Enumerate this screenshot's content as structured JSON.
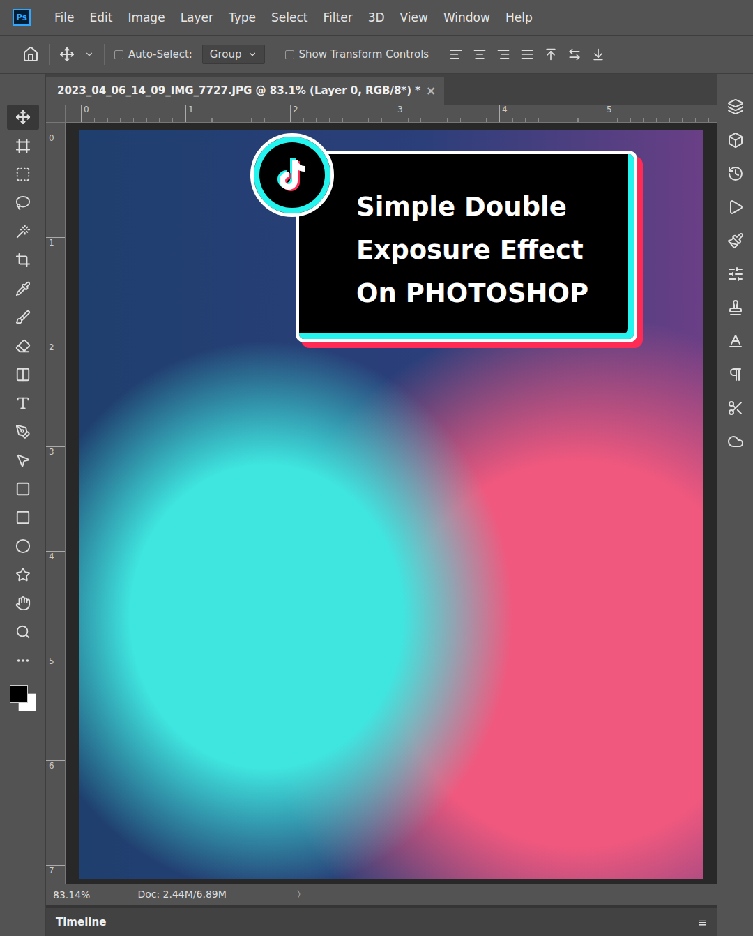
{
  "app": {
    "logo": "Ps"
  },
  "menu": [
    "File",
    "Edit",
    "Image",
    "Layer",
    "Type",
    "Select",
    "Filter",
    "3D",
    "View",
    "Window",
    "Help"
  ],
  "options": {
    "auto_select": {
      "label": "Auto-Select:",
      "checked": false
    },
    "dropdown": "Group",
    "transform": {
      "label": "Show Transform Controls",
      "checked": false
    }
  },
  "document_tab": {
    "title": "2023_04_06_14_09_IMG_7727.JPG @ 83.1% (Layer 0, RGB/8*) *",
    "close": "×",
    "selected": true
  },
  "rulers": {
    "horizontal": [
      "0",
      "1",
      "2",
      "3",
      "4",
      "5"
    ],
    "vertical": [
      "0",
      "1",
      "2",
      "3",
      "4",
      "5",
      "6",
      "7"
    ]
  },
  "tools": [
    {
      "selected": true
    },
    {
      "selected": false
    },
    {
      "selected": false
    },
    {
      "selected": false
    },
    {
      "selected": false
    },
    {
      "selected": false
    },
    {
      "selected": false
    },
    {
      "selected": false
    },
    {
      "selected": false
    },
    {
      "selected": false
    },
    {
      "selected": false
    },
    {
      "selected": false
    },
    {
      "selected": false
    },
    {
      "selected": false
    },
    {
      "selected": false
    },
    {
      "selected": false
    },
    {
      "selected": false
    },
    {
      "selected": false
    },
    {
      "selected": false
    },
    {
      "selected": false
    }
  ],
  "caption": {
    "lines": [
      "Simple Double",
      "Exposure Effect",
      "On PHOTOSHOP"
    ]
  },
  "status_bar": {
    "zoom": "83.14%",
    "doc": "Doc: 2.44M/6.89M",
    "arrow": "〉"
  },
  "timeline": {
    "label": "Timeline",
    "menu": "≡"
  }
}
